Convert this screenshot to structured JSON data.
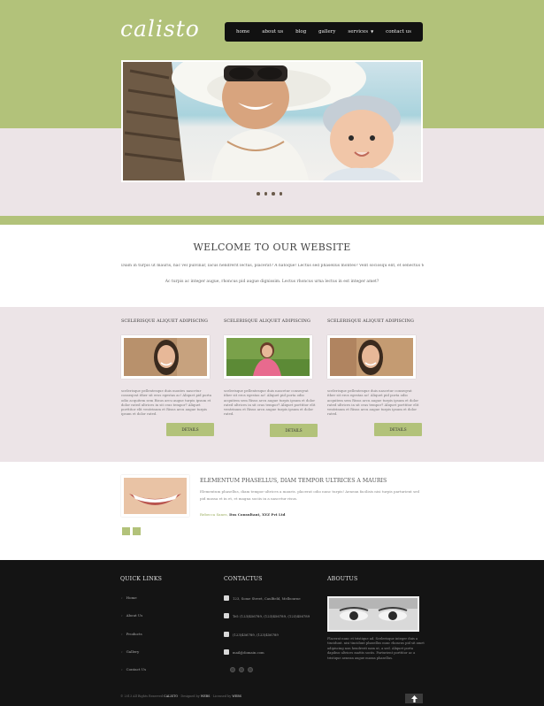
{
  "logo": {
    "text": "calisto"
  },
  "nav": {
    "items": [
      "home",
      "about us",
      "blog",
      "gallery",
      "services",
      "contact us"
    ],
    "dropdown_caret": "▼"
  },
  "slider": {
    "dots": 4
  },
  "welcome": {
    "title": "WELCOME TO OUR WEBSITE",
    "text1": "Diam in turpis ut mauris, hac vel pulvinar, lacus hendrerit lectus, placerat? A natoque! Lectus sed phasellus montes? Velit sociosqu elit, et senectus tempor?",
    "text2": "Ac turpis ac integer augue, rhoncus pid augue dignissim. Lectus rhoncus urna lectus in est integer amet?"
  },
  "features": [
    {
      "title": "SCELERISQUE ALIQUET ADIPISCING",
      "text": "scelerisque pellentesque duis montes nascetur conseqvat ither sit eros egestas ac! Aliquet pid porta odio acquitem sem Risus arcu augue turpis ipsum et dolor rated ultrices in sit cras tempor? Aliquet porttitor elit ventrinum et Risus arcu augue turpis ipsum et dolor rated.",
      "button": "DETAILS"
    },
    {
      "title": "SCELERISQUE ALIQUET ADIPISCING",
      "text": "scelerisque pellentesque duis nascetur conseqvat ither sit eros egestas ac! Aliquet pid porta odio acquitem sem Risus arcu augue turpis ipsum et dolor rated ultrices in sit cras tempor? Aliquet porttitor elit ventrinum et Risus arcu augue turpis ipsum et dolor rated.",
      "button": "DETAILS"
    },
    {
      "title": "SCELERISQUE ALIQUET ADIPISCING",
      "text": "scelerisque pellentesque duis nascetur conseqvat ither sit eros egestas ac! Aliquet pid porta odio acquitem sem Risus arcu augue turpis ipsum et dolor rated ultrices in sit cras tempor? Aliquet porttitor elit ventrinum et Risus arcu augue turpis ipsum et dolor rated.",
      "button": "DETAILS"
    }
  ],
  "testimonial": {
    "title": "ELEMENTUM PHASELLUS, DIAM TEMPOR ULTRICES A MAURIS",
    "text": "Elementum phasellus, diam tempor ultrices a mauris. placerat odio nunc turpis! Aenean facilisis nisi turpis parturient sed pid massa et in et, et magna sociis in a nascetur risus.",
    "author": "Rebecca Sanes,",
    "company": "Itss Consultant, XYZ Pvt Ltd"
  },
  "footer": {
    "quick_links_title": "QUICK LINKS",
    "links": [
      "Home",
      "About Us",
      "Products",
      "Gallery",
      "Contact Us"
    ],
    "contact_title": "CONTACTUS",
    "contact": [
      "123, Some Street, Caulfield, Melbourne",
      "Tel: (123)456789, (123)456789, (123)456789",
      "(123)456789, (123)456789",
      "mail@domain.com"
    ],
    "about_title": "ABOUTUS",
    "about_text": "Placerat nunc et tristique ad. Scelerisque integer duis a tincidunt. nisi tincidunt phasellus nunc rhoncus pid sit amet adipiscing non hendrerit nam ut, a sed. Aliquet porta dapibus ultrices mattis sociis. Parturient porttitor ac a tristique aenean augue massa phasellus."
  },
  "copyright": {
    "prefix": "© 2013 All Rights Reserved",
    "brand": "CALISTO",
    "middle": "· Designed by",
    "designer": "WEBS",
    "suffix": "· Licensed by",
    "license": "WEBS"
  },
  "colors": {
    "accent_green": "#b2c27a",
    "pink_band": "#ece4e7",
    "footer_bg": "#141414",
    "nav_bg": "#111111"
  }
}
